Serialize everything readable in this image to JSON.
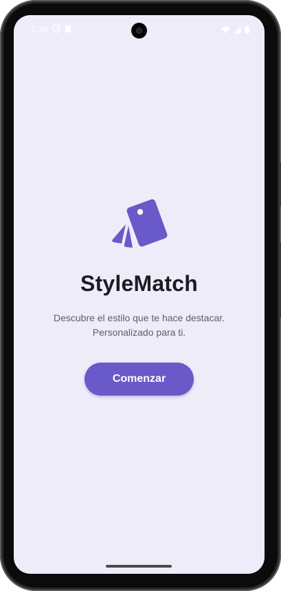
{
  "status_bar": {
    "time": "5:35",
    "icons": [
      "vpn-shield-icon",
      "sd-card-icon",
      "wifi-icon",
      "cellular-signal-icon",
      "battery-icon"
    ]
  },
  "app": {
    "name": "StyleMatch",
    "logo_icon": "swatch-cards-icon",
    "tagline_line1": "Descubre el estilo que te hace destacar.",
    "tagline_line2": "Personalizado para ti."
  },
  "actions": {
    "start_label": "Comenzar"
  },
  "colors": {
    "background": "#efecfa",
    "accent": "#6a59c8",
    "title": "#1d1b22",
    "subtitle": "#605d68"
  }
}
